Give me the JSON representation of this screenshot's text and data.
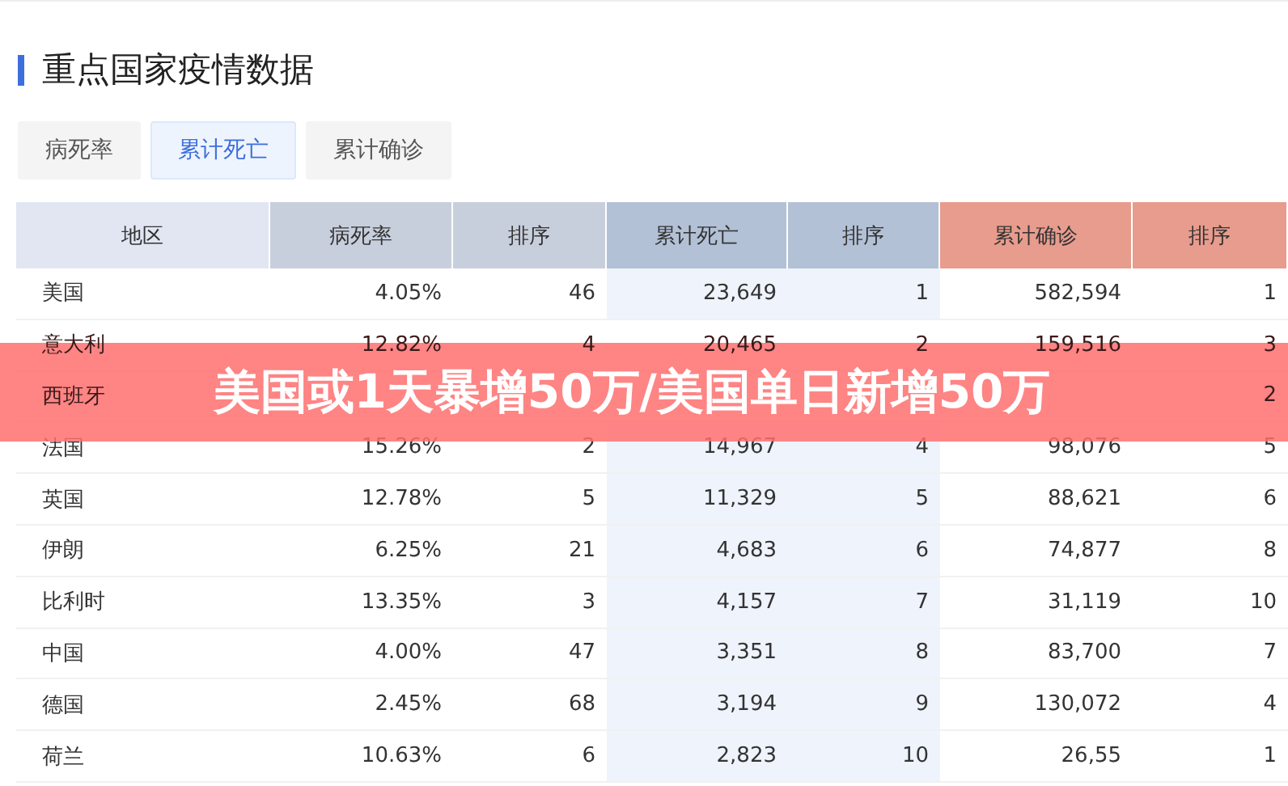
{
  "title": "重点国家疫情数据",
  "tabs": [
    {
      "label": "病死率",
      "selected": false
    },
    {
      "label": "累计死亡",
      "selected": true
    },
    {
      "label": "累计确诊",
      "selected": false
    }
  ],
  "table": {
    "columns": [
      "地区",
      "病死率",
      "排序",
      "累计死亡",
      "排序",
      "累计确诊",
      "排序"
    ],
    "rows": [
      {
        "cells": [
          "美国",
          "4.05%",
          "46",
          "23,649",
          "1",
          "582,594",
          "1"
        ]
      },
      {
        "cells": [
          "意大利",
          "12.82%",
          "4",
          "20,465",
          "2",
          "159,516",
          "3"
        ]
      },
      {
        "cells": [
          "西班牙",
          null,
          null,
          null,
          null,
          null,
          "2"
        ]
      },
      {
        "cells": [
          "法国",
          "15.26%",
          "2",
          "14,967",
          "4",
          "98,076",
          "5"
        ]
      },
      {
        "cells": [
          "英国",
          "12.78%",
          "5",
          "11,329",
          "5",
          "88,621",
          "6"
        ]
      },
      {
        "cells": [
          "伊朗",
          "6.25%",
          "21",
          "4,683",
          "6",
          "74,877",
          "8"
        ]
      },
      {
        "cells": [
          "比利时",
          "13.35%",
          "3",
          "4,157",
          "7",
          "31,119",
          "10"
        ]
      },
      {
        "cells": [
          "中国",
          "4.00%",
          "47",
          "3,351",
          "8",
          "83,700",
          "7"
        ]
      },
      {
        "cells": [
          "德国",
          "2.45%",
          "68",
          "3,194",
          "9",
          "130,072",
          "4"
        ]
      },
      {
        "cells": [
          "荷兰",
          "10.63%",
          "6",
          "2,823",
          "10",
          "26,55",
          "1"
        ]
      }
    ]
  },
  "banner": "美国或1天暴增50万/美国单日新增50万"
}
